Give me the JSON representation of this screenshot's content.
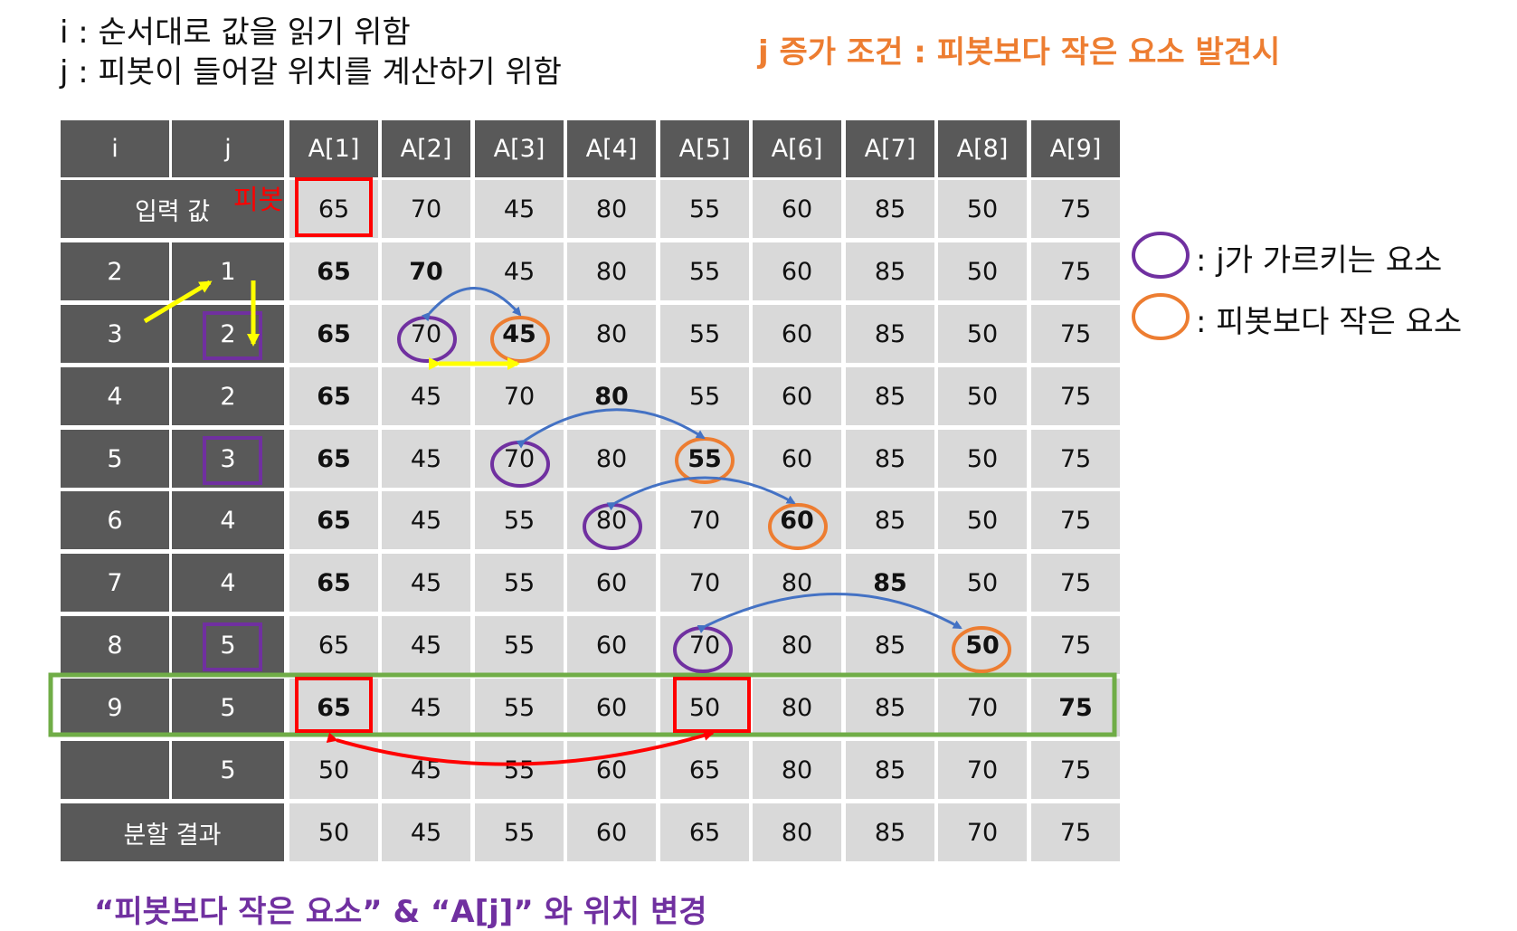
{
  "desc": {
    "line_i": "i : 순서대로 값을 읽기 위함",
    "line_j": "j : 피봇이 들어갈 위치를 계산하기 위함"
  },
  "condition": "j 증가 조건 : 피봇보다 작은 요소 발견시",
  "table": {
    "headers": [
      "i",
      "j",
      "A[1]",
      "A[2]",
      "A[3]",
      "A[4]",
      "A[5]",
      "A[6]",
      "A[7]",
      "A[8]",
      "A[9]"
    ],
    "pivot_label": "피봇",
    "rows": [
      {
        "label": "입력 값",
        "i": "",
        "j": "",
        "values": [
          "65",
          "70",
          "45",
          "80",
          "55",
          "60",
          "85",
          "50",
          "75"
        ],
        "bold": []
      },
      {
        "label": "",
        "i": "2",
        "j": "1",
        "values": [
          "65",
          "70",
          "45",
          "80",
          "55",
          "60",
          "85",
          "50",
          "75"
        ],
        "bold": [
          0,
          1
        ]
      },
      {
        "label": "",
        "i": "3",
        "j": "2",
        "values": [
          "65",
          "70",
          "45",
          "80",
          "55",
          "60",
          "85",
          "50",
          "75"
        ],
        "bold": [
          0,
          2
        ]
      },
      {
        "label": "",
        "i": "4",
        "j": "2",
        "values": [
          "65",
          "45",
          "70",
          "80",
          "55",
          "60",
          "85",
          "50",
          "75"
        ],
        "bold": [
          0,
          3
        ]
      },
      {
        "label": "",
        "i": "5",
        "j": "3",
        "values": [
          "65",
          "45",
          "70",
          "80",
          "55",
          "60",
          "85",
          "50",
          "75"
        ],
        "bold": [
          0,
          4
        ]
      },
      {
        "label": "",
        "i": "6",
        "j": "4",
        "values": [
          "65",
          "45",
          "55",
          "80",
          "70",
          "60",
          "85",
          "50",
          "75"
        ],
        "bold": [
          0,
          5
        ]
      },
      {
        "label": "",
        "i": "7",
        "j": "4",
        "values": [
          "65",
          "45",
          "55",
          "60",
          "70",
          "80",
          "85",
          "50",
          "75"
        ],
        "bold": [
          0,
          6
        ]
      },
      {
        "label": "",
        "i": "8",
        "j": "5",
        "values": [
          "65",
          "45",
          "55",
          "60",
          "70",
          "80",
          "85",
          "50",
          "75"
        ],
        "bold": [
          7
        ]
      },
      {
        "label": "",
        "i": "9",
        "j": "5",
        "values": [
          "65",
          "45",
          "55",
          "60",
          "50",
          "80",
          "85",
          "70",
          "75"
        ],
        "bold": [
          0,
          8
        ]
      },
      {
        "label": "",
        "i": "",
        "j": "5",
        "values": [
          "50",
          "45",
          "55",
          "60",
          "65",
          "80",
          "85",
          "70",
          "75"
        ],
        "bold": []
      },
      {
        "label": "분할 결과",
        "i": "",
        "j": "",
        "values": [
          "50",
          "45",
          "55",
          "60",
          "65",
          "80",
          "85",
          "70",
          "75"
        ],
        "bold": []
      }
    ]
  },
  "legend": {
    "purple": ": j가 가르키는 요소",
    "orange": ": 피봇보다 작은 요소"
  },
  "footer": "“피봇보다 작은 요소” & “A[j]” 와 위치 변경",
  "colors": {
    "header_bg": "#595959",
    "cell_bg": "#D9D9D9",
    "purple": "#7030A0",
    "orange": "#ED7D31",
    "red": "#FF0000",
    "blue": "#4472C4",
    "yellow": "#FFFF00",
    "green": "#70AD47"
  }
}
